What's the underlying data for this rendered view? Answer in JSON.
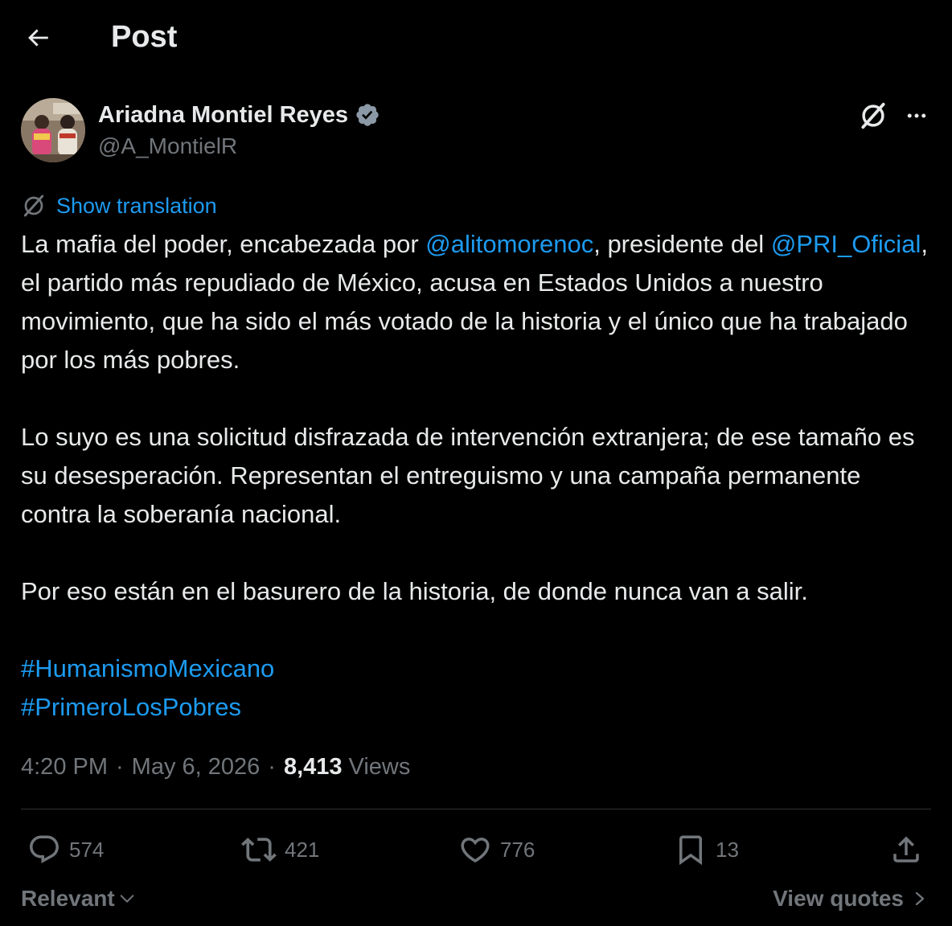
{
  "header": {
    "title": "Post",
    "back_icon": "arrow-left-icon"
  },
  "author": {
    "name": "Ariadna Montiel Reyes",
    "handle": "@A_MontielR",
    "verified": true,
    "verified_color": "#8b98a5"
  },
  "translate": {
    "label": "Show translation"
  },
  "post": {
    "p1": {
      "t1": "La mafia del poder, encabezada por ",
      "m1": "@alitomorenoc",
      "t2": ", presidente del ",
      "m2": "@PRI_Oficial",
      "t3": ", el partido más repudiado de México, acusa en Estados Unidos a nuestro movimiento, que ha sido el más votado de la historia y el único que ha trabajado por los más pobres."
    },
    "p2": "Lo suyo es una solicitud disfrazada de intervención extranjera; de ese tamaño es su desesperación. Representan el entreguismo y una campaña permanente contra la soberanía nacional.",
    "p3": "Por eso están en el basurero de la historia, de donde nunca van a salir.",
    "hashtags": [
      "#HumanismoMexicano",
      "#PrimeroLosPobres"
    ]
  },
  "meta": {
    "time": "4:20 PM",
    "date": "May 6, 2026",
    "views_count": "8,413",
    "views_label": "Views",
    "separator": "·"
  },
  "actions": {
    "replies": "574",
    "reposts": "421",
    "likes": "776",
    "bookmarks": "13"
  },
  "footer": {
    "sort_label": "Relevant",
    "quotes_label": "View quotes"
  },
  "colors": {
    "background": "#000000",
    "text": "#e7e9ea",
    "muted": "#71767b",
    "accent": "#1d9bf0",
    "divider": "#2f3336"
  }
}
